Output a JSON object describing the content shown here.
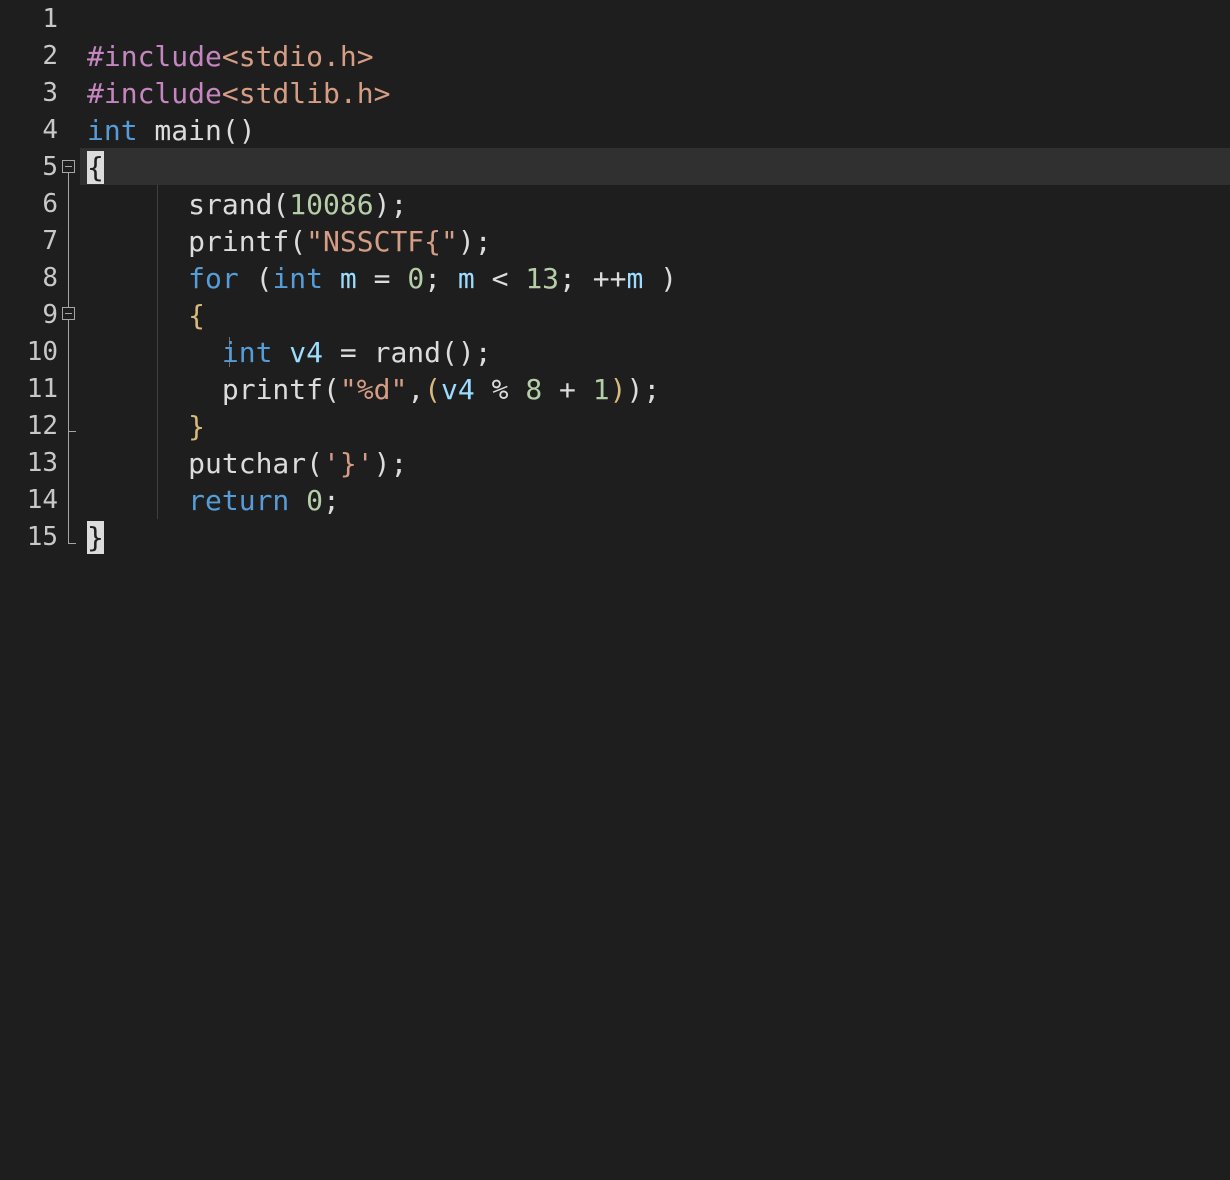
{
  "editor": {
    "lines": [
      {
        "n": "1",
        "tokens": []
      },
      {
        "n": "2",
        "tokens": [
          {
            "c": "pp",
            "t": "#include"
          },
          {
            "c": "str",
            "t": "<stdio.h>"
          }
        ]
      },
      {
        "n": "3",
        "tokens": [
          {
            "c": "pp",
            "t": "#include"
          },
          {
            "c": "str",
            "t": "<stdlib.h>"
          }
        ]
      },
      {
        "n": "4",
        "tokens": [
          {
            "c": "kw",
            "t": "int"
          },
          {
            "c": "fn2",
            "t": " main()"
          }
        ]
      },
      {
        "n": "5",
        "tokens": [
          {
            "c": "hl-brace",
            "t": "{"
          }
        ]
      },
      {
        "n": "6",
        "tokens": [
          {
            "c": "fn2",
            "t": "      srand("
          },
          {
            "c": "num",
            "t": "10086"
          },
          {
            "c": "fn2",
            "t": ");"
          }
        ]
      },
      {
        "n": "7",
        "tokens": [
          {
            "c": "fn2",
            "t": "      printf("
          },
          {
            "c": "str",
            "t": "\"NSSCTF{\""
          },
          {
            "c": "fn2",
            "t": ");"
          }
        ]
      },
      {
        "n": "8",
        "tokens": [
          {
            "c": "kw",
            "t": "      for"
          },
          {
            "c": "fn2",
            "t": " ("
          },
          {
            "c": "kw",
            "t": "int"
          },
          {
            "c": "var",
            "t": " m"
          },
          {
            "c": "fn2",
            "t": " = "
          },
          {
            "c": "num",
            "t": "0"
          },
          {
            "c": "fn2",
            "t": ";"
          },
          {
            "c": "var",
            "t": " m"
          },
          {
            "c": "fn2",
            "t": " < "
          },
          {
            "c": "num",
            "t": "13"
          },
          {
            "c": "fn2",
            "t": "; ++"
          },
          {
            "c": "var",
            "t": "m"
          },
          {
            "c": "fn2",
            "t": " )"
          }
        ]
      },
      {
        "n": "9",
        "tokens": [
          {
            "c": "brace-orange",
            "t": "      {"
          }
        ]
      },
      {
        "n": "10",
        "tokens": [
          {
            "c": "kw",
            "t": "        int"
          },
          {
            "c": "var",
            "t": " v4"
          },
          {
            "c": "fn2",
            "t": " = rand();"
          }
        ]
      },
      {
        "n": "11",
        "tokens": [
          {
            "c": "fn2",
            "t": "        printf("
          },
          {
            "c": "str",
            "t": "\"%d\""
          },
          {
            "c": "fn2",
            "t": ","
          },
          {
            "c": "brace-orange",
            "t": "("
          },
          {
            "c": "var",
            "t": "v4"
          },
          {
            "c": "fn2",
            "t": " % "
          },
          {
            "c": "num",
            "t": "8"
          },
          {
            "c": "fn2",
            "t": " + "
          },
          {
            "c": "num",
            "t": "1"
          },
          {
            "c": "brace-orange",
            "t": ")"
          },
          {
            "c": "fn2",
            "t": ");"
          }
        ]
      },
      {
        "n": "12",
        "tokens": [
          {
            "c": "brace-orange",
            "t": "      }"
          }
        ]
      },
      {
        "n": "13",
        "tokens": [
          {
            "c": "fn2",
            "t": "      putchar("
          },
          {
            "c": "str",
            "t": "'}'"
          },
          {
            "c": "fn2",
            "t": ");"
          }
        ]
      },
      {
        "n": "14",
        "tokens": [
          {
            "c": "kw",
            "t": "      return"
          },
          {
            "c": "num",
            "t": " 0"
          },
          {
            "c": "fn2",
            "t": ";"
          }
        ]
      },
      {
        "n": "15",
        "tokens": [
          {
            "c": "hl-brace",
            "t": "}"
          }
        ]
      }
    ],
    "current_line": "5",
    "colors": {
      "background": "#1e1e1e",
      "keyword": "#569cd6",
      "preprocessor": "#c586c0",
      "string": "#d69d85",
      "number": "#b5cea8"
    }
  }
}
